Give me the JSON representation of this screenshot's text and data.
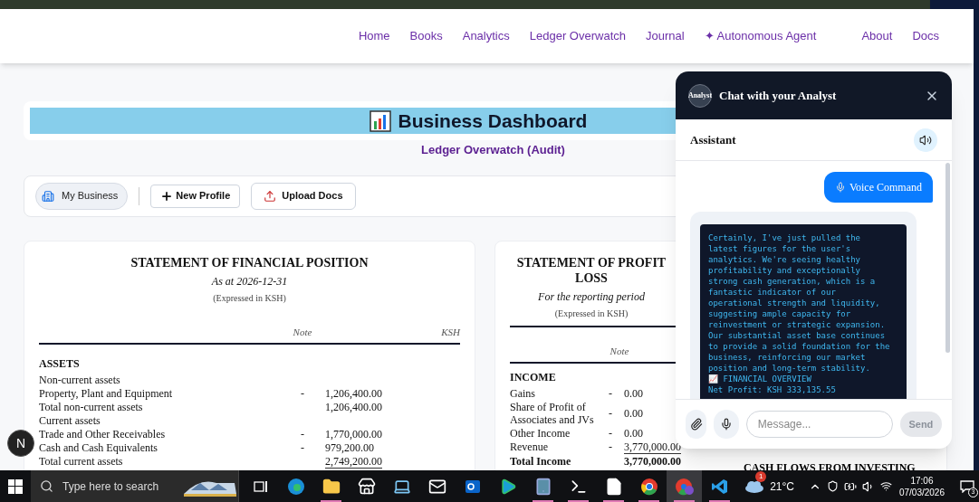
{
  "nav": {
    "links": [
      "Home",
      "Books",
      "Analytics",
      "Ledger Overwatch",
      "Journal",
      "✦ Autonomous Agent"
    ],
    "secondary_links": [
      "About",
      "Docs"
    ]
  },
  "dashboard": {
    "title": "Business Dashboard",
    "subtitle": "Ledger Overwatch (Audit)"
  },
  "toolbar": {
    "buttons": [
      {
        "kind": "profile",
        "label": "My Business"
      },
      {
        "kind": "new",
        "label": "New Profile"
      },
      {
        "kind": "upload",
        "label": "Upload Docs"
      }
    ]
  },
  "financial_position": {
    "title": "STATEMENT OF FINANCIAL POSITION",
    "period": "As at 2026-12-31",
    "currency_note": "(Expressed in KSH)",
    "columns": [
      "Note",
      "KSH"
    ],
    "sections": [
      {
        "heading": "ASSETS",
        "rows": [
          {
            "kind": "group",
            "label": "Non-current assets"
          },
          {
            "kind": "item",
            "label": "Property, Plant and Equipment",
            "note": "-",
            "amount": "1,206,400.00",
            "underlined": false
          },
          {
            "kind": "item",
            "label": "Total non-current assets",
            "amount": "1,206,400.00",
            "underlined": false
          },
          {
            "kind": "group",
            "label": "Current assets"
          },
          {
            "kind": "item",
            "label": "Trade and Other Receivables",
            "note": "-",
            "amount": "1,770,000.00",
            "underlined": false
          },
          {
            "kind": "item",
            "label": "Cash and Cash Equivalents",
            "note": "-",
            "amount": "979,200.00",
            "underlined": false
          },
          {
            "kind": "item",
            "label": "Total current assets",
            "amount": "2,749,200.00",
            "underlined": true
          }
        ]
      }
    ]
  },
  "profit_or_loss": {
    "title_lines": [
      "STATEMENT OF PROFIT",
      "LOSS"
    ],
    "period": "For the reporting period",
    "currency_note": "(Expressed in KSH)",
    "columns": [
      "Note"
    ],
    "sections": [
      {
        "heading": "INCOME",
        "rows": [
          {
            "kind": "item",
            "label": "Gains",
            "note": "-",
            "amount": "0.00",
            "underlined": false
          },
          {
            "kind": "item",
            "label": "Share of Profit of Associates and JVs",
            "note": "-",
            "amount": "0.00",
            "underlined": false
          },
          {
            "kind": "item",
            "label": "Other Income",
            "note": "-",
            "amount": "0.00",
            "underlined": false
          },
          {
            "kind": "item",
            "label": "Revenue",
            "note": "-",
            "amount": "3,770,000.00",
            "underlined": true
          },
          {
            "kind": "total",
            "label": "Total Income",
            "amount": "3,770,000.00",
            "underlined": false
          }
        ]
      }
    ]
  },
  "cash_flows": {
    "heading": "CASH FLOWS FROM INVESTING"
  },
  "chat": {
    "title": "Chat with your Analyst",
    "avatar_label": "Analyst",
    "agent_label": "Assistant",
    "messages": [
      {
        "kind": "user",
        "text": "Voice Command"
      },
      {
        "kind": "assistant",
        "text": "Certainly, I've just pulled the latest figures for the user's analytics. We're seeing healthy profitability and exceptionally strong cash generation, which is a fantastic indicator of our operational strength and liquidity, suggesting ample capacity for reinvestment or strategic expansion. Our substantial asset base continues to provide a solid foundation for the business, reinforcing our market position and long-term stability.",
        "lines": [
          "📈 FINANCIAL OVERVIEW",
          "Net Profit: KSH 333,135.55"
        ]
      }
    ],
    "input": {
      "placeholder": "Message..."
    },
    "send": {
      "label": "Send",
      "disabled": true
    }
  },
  "dev_indicator": {
    "label": "N"
  },
  "taskbar": {
    "search_placeholder": "Type here to search",
    "apps": [
      {
        "kind": "taskview",
        "running": false,
        "selected": false
      },
      {
        "kind": "edge",
        "running": false,
        "selected": false
      },
      {
        "kind": "explorer",
        "running": true,
        "selected": false
      },
      {
        "kind": "store",
        "running": false,
        "selected": false
      },
      {
        "kind": "device",
        "running": false,
        "selected": false
      },
      {
        "kind": "mail",
        "running": false,
        "selected": false
      },
      {
        "kind": "outlook",
        "running": false,
        "selected": false
      },
      {
        "kind": "play",
        "running": false,
        "selected": false
      },
      {
        "kind": "tablet",
        "running": true,
        "selected": false
      },
      {
        "kind": "terminal",
        "running": true,
        "selected": false
      },
      {
        "kind": "file",
        "running": true,
        "selected": false
      },
      {
        "kind": "chrome",
        "running": true,
        "selected": false
      },
      {
        "kind": "chrome_profile",
        "running": true,
        "selected": true
      },
      {
        "kind": "vscode",
        "running": true,
        "selected": false
      }
    ],
    "weather": {
      "temperature": "21°C",
      "badge": "1"
    },
    "time": "17:06",
    "date": "07/03/2026",
    "notifications": "3"
  }
}
